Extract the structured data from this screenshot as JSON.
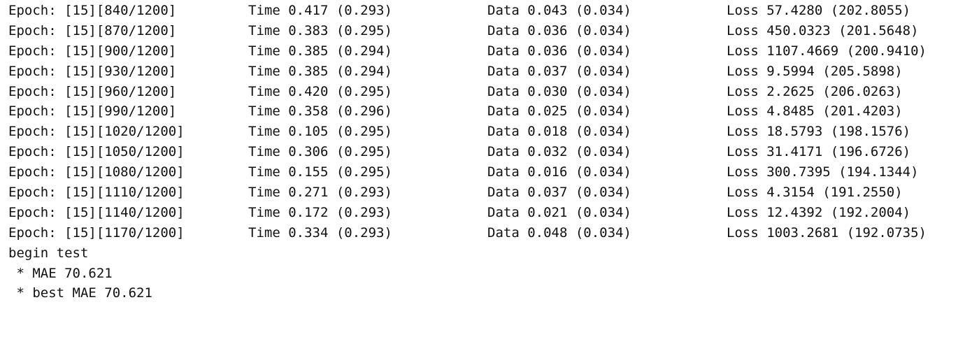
{
  "log_rows": [
    {
      "epoch": "Epoch: [15][840/1200]",
      "time": "Time 0.417 (0.293)",
      "data": "Data 0.043 (0.034)",
      "loss": "Loss 57.4280 (202.8055)"
    },
    {
      "epoch": "Epoch: [15][870/1200]",
      "time": "Time 0.383 (0.295)",
      "data": "Data 0.036 (0.034)",
      "loss": "Loss 450.0323 (201.5648)"
    },
    {
      "epoch": "Epoch: [15][900/1200]",
      "time": "Time 0.385 (0.294)",
      "data": "Data 0.036 (0.034)",
      "loss": "Loss 1107.4669 (200.9410)"
    },
    {
      "epoch": "Epoch: [15][930/1200]",
      "time": "Time 0.385 (0.294)",
      "data": "Data 0.037 (0.034)",
      "loss": "Loss 9.5994 (205.5898)"
    },
    {
      "epoch": "Epoch: [15][960/1200]",
      "time": "Time 0.420 (0.295)",
      "data": "Data 0.030 (0.034)",
      "loss": "Loss 2.2625 (206.0263)"
    },
    {
      "epoch": "Epoch: [15][990/1200]",
      "time": "Time 0.358 (0.296)",
      "data": "Data 0.025 (0.034)",
      "loss": "Loss 4.8485 (201.4203)"
    },
    {
      "epoch": "Epoch: [15][1020/1200]",
      "time": "Time 0.105 (0.295)",
      "data": "Data 0.018 (0.034)",
      "loss": "Loss 18.5793 (198.1576)"
    },
    {
      "epoch": "Epoch: [15][1050/1200]",
      "time": "Time 0.306 (0.295)",
      "data": "Data 0.032 (0.034)",
      "loss": "Loss 31.4171 (196.6726)"
    },
    {
      "epoch": "Epoch: [15][1080/1200]",
      "time": "Time 0.155 (0.295)",
      "data": "Data 0.016 (0.034)",
      "loss": "Loss 300.7395 (194.1344)"
    },
    {
      "epoch": "Epoch: [15][1110/1200]",
      "time": "Time 0.271 (0.293)",
      "data": "Data 0.037 (0.034)",
      "loss": "Loss 4.3154 (191.2550)"
    },
    {
      "epoch": "Epoch: [15][1140/1200]",
      "time": "Time 0.172 (0.293)",
      "data": "Data 0.021 (0.034)",
      "loss": "Loss 12.4392 (192.2004)"
    },
    {
      "epoch": "Epoch: [15][1170/1200]",
      "time": "Time 0.334 (0.293)",
      "data": "Data 0.048 (0.034)",
      "loss": "Loss 1003.2681 (192.0735)"
    }
  ],
  "test": {
    "begin": "begin test",
    "mae": " * MAE 70.621",
    "best_mae": " * best MAE 70.621"
  }
}
